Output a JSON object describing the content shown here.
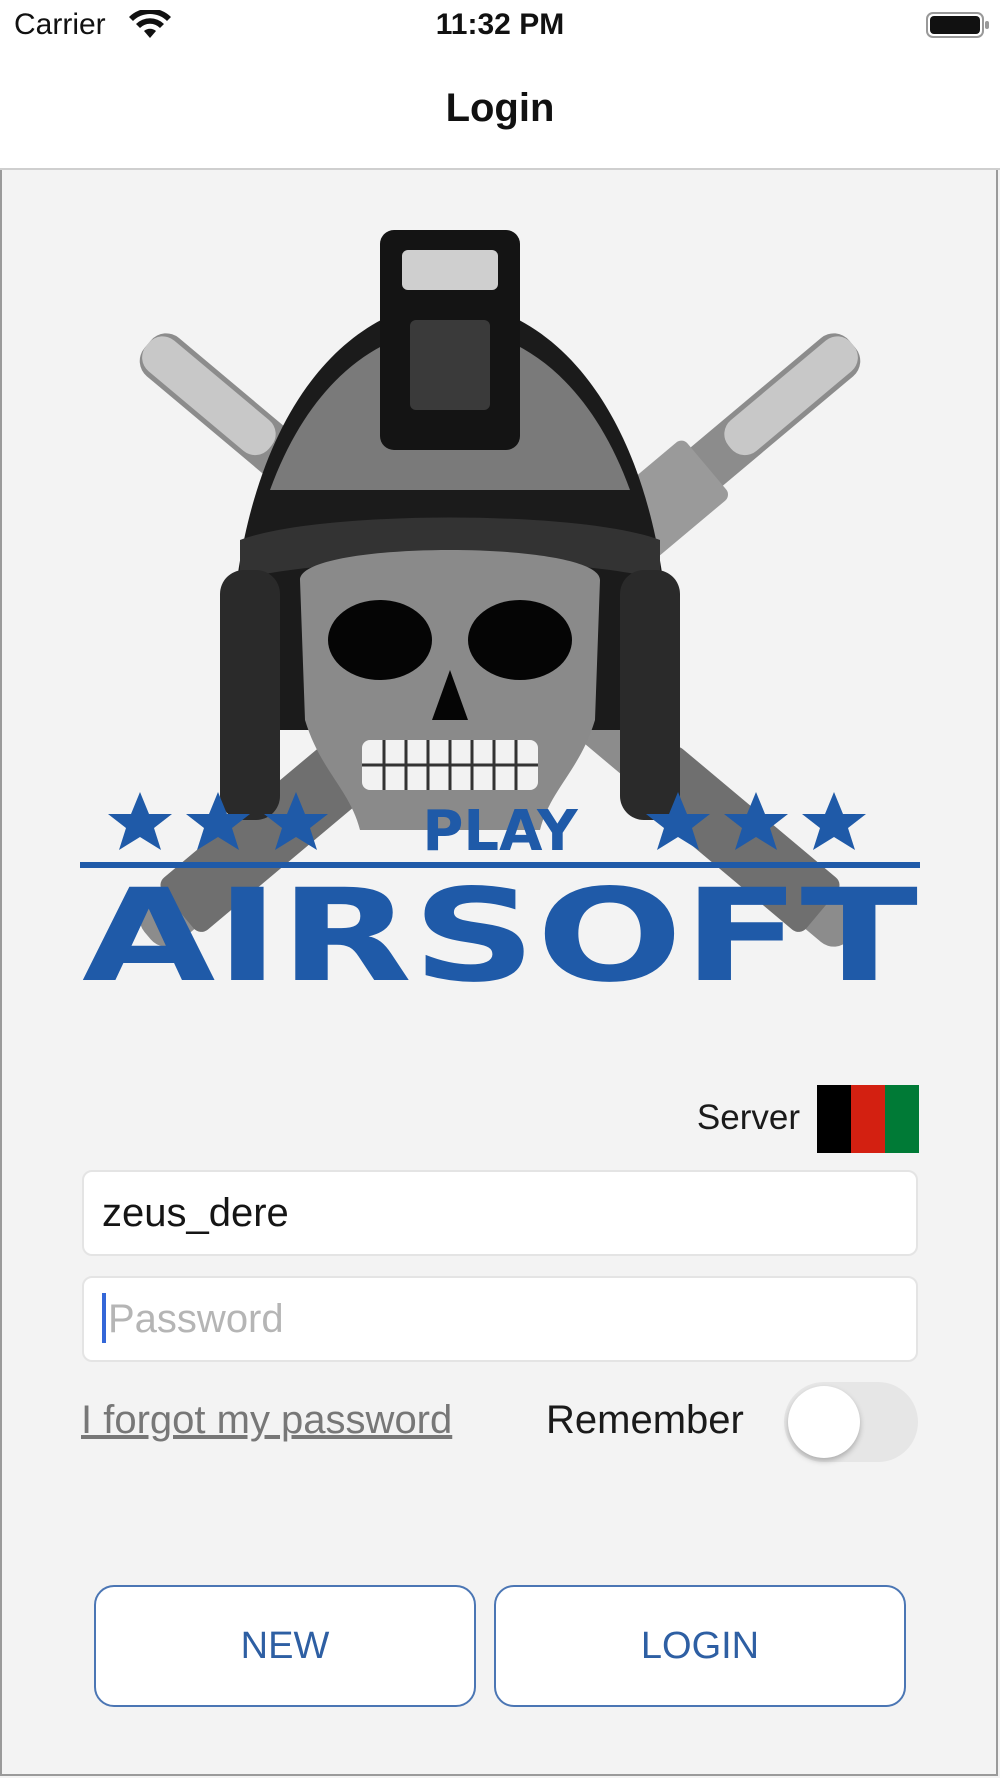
{
  "status_bar": {
    "carrier": "Carrier",
    "time": "11:32 PM",
    "wifi_icon": "wifi-icon",
    "battery_icon": "battery-icon"
  },
  "nav": {
    "title": "Login"
  },
  "logo": {
    "top_text": "PLAY",
    "main_text": "AIRSOFT",
    "brand_blue": "#1f5aa8"
  },
  "server": {
    "label": "Server",
    "flag_icon": "afghanistan-flag-icon",
    "flag_colors": [
      "#000000",
      "#d32011",
      "#007a36"
    ]
  },
  "form": {
    "username_value": "zeus_dere",
    "password_placeholder": "Password",
    "forgot_link": "I forgot my password",
    "remember_label": "Remember",
    "remember_on": false
  },
  "buttons": {
    "new_label": "NEW",
    "login_label": "LOGIN"
  },
  "colors": {
    "accent": "#2e5fa3",
    "background": "#f3f3f3"
  }
}
